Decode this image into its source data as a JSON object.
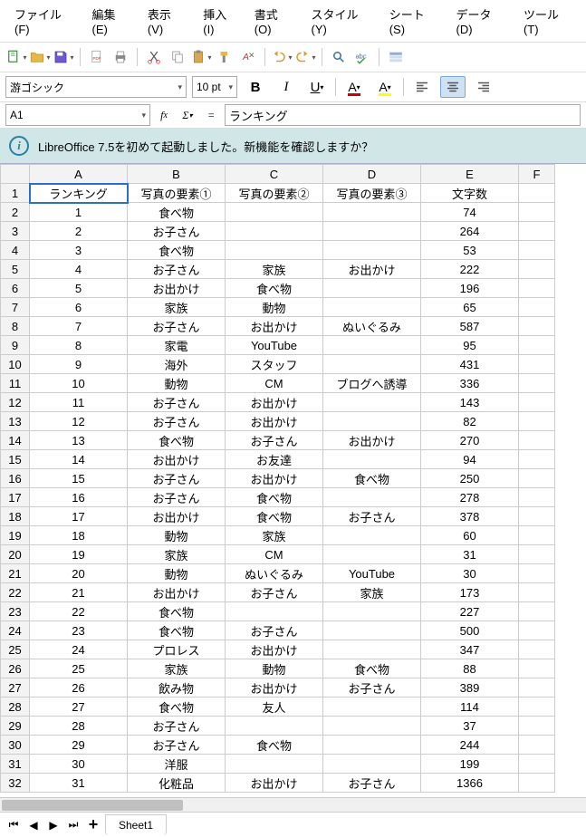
{
  "menu": {
    "file": "ファイル(F)",
    "edit": "編集(E)",
    "view": "表示(V)",
    "insert": "挿入(I)",
    "format": "書式(O)",
    "styles": "スタイル(Y)",
    "sheet": "シート(S)",
    "data": "データ(D)",
    "tools": "ツール(T)"
  },
  "format_bar": {
    "font_name": "游ゴシック",
    "font_size": "10 pt"
  },
  "formula_bar": {
    "cell_ref": "A1",
    "content": "ランキング"
  },
  "infobar": {
    "message": "LibreOffice 7.5を初めて起動しました。新機能を確認しますか？"
  },
  "columns": [
    "A",
    "B",
    "C",
    "D",
    "E",
    "F"
  ],
  "headers": {
    "A": "ランキング",
    "B": "写真の要素①",
    "C": "写真の要素②",
    "D": "写真の要素③",
    "E": "文字数"
  },
  "rows": [
    {
      "n": 1,
      "A": "ランキング",
      "B": "写真の要素①",
      "C": "写真の要素②",
      "D": "写真の要素③",
      "E": "文字数"
    },
    {
      "n": 2,
      "A": "1",
      "B": "食べ物",
      "C": "",
      "D": "",
      "E": "74"
    },
    {
      "n": 3,
      "A": "2",
      "B": "お子さん",
      "C": "",
      "D": "",
      "E": "264"
    },
    {
      "n": 4,
      "A": "3",
      "B": "食べ物",
      "C": "",
      "D": "",
      "E": "53"
    },
    {
      "n": 5,
      "A": "4",
      "B": "お子さん",
      "C": "家族",
      "D": "お出かけ",
      "E": "222"
    },
    {
      "n": 6,
      "A": "5",
      "B": "お出かけ",
      "C": "食べ物",
      "D": "",
      "E": "196"
    },
    {
      "n": 7,
      "A": "6",
      "B": "家族",
      "C": "動物",
      "D": "",
      "E": "65"
    },
    {
      "n": 8,
      "A": "7",
      "B": "お子さん",
      "C": "お出かけ",
      "D": "ぬいぐるみ",
      "E": "587"
    },
    {
      "n": 9,
      "A": "8",
      "B": "家電",
      "C": "YouTube",
      "D": "",
      "E": "95"
    },
    {
      "n": 10,
      "A": "9",
      "B": "海外",
      "C": "スタッフ",
      "D": "",
      "E": "431"
    },
    {
      "n": 11,
      "A": "10",
      "B": "動物",
      "C": "CM",
      "D": "ブログへ誘導",
      "E": "336"
    },
    {
      "n": 12,
      "A": "11",
      "B": "お子さん",
      "C": "お出かけ",
      "D": "",
      "E": "143"
    },
    {
      "n": 13,
      "A": "12",
      "B": "お子さん",
      "C": "お出かけ",
      "D": "",
      "E": "82"
    },
    {
      "n": 14,
      "A": "13",
      "B": "食べ物",
      "C": "お子さん",
      "D": "お出かけ",
      "E": "270"
    },
    {
      "n": 15,
      "A": "14",
      "B": "お出かけ",
      "C": "お友達",
      "D": "",
      "E": "94"
    },
    {
      "n": 16,
      "A": "15",
      "B": "お子さん",
      "C": "お出かけ",
      "D": "食べ物",
      "E": "250"
    },
    {
      "n": 17,
      "A": "16",
      "B": "お子さん",
      "C": "食べ物",
      "D": "",
      "E": "278"
    },
    {
      "n": 18,
      "A": "17",
      "B": "お出かけ",
      "C": "食べ物",
      "D": "お子さん",
      "E": "378"
    },
    {
      "n": 19,
      "A": "18",
      "B": "動物",
      "C": "家族",
      "D": "",
      "E": "60"
    },
    {
      "n": 20,
      "A": "19",
      "B": "家族",
      "C": "CM",
      "D": "",
      "E": "31"
    },
    {
      "n": 21,
      "A": "20",
      "B": "動物",
      "C": "ぬいぐるみ",
      "D": "YouTube",
      "E": "30"
    },
    {
      "n": 22,
      "A": "21",
      "B": "お出かけ",
      "C": "お子さん",
      "D": "家族",
      "E": "173"
    },
    {
      "n": 23,
      "A": "22",
      "B": "食べ物",
      "C": "",
      "D": "",
      "E": "227"
    },
    {
      "n": 24,
      "A": "23",
      "B": "食べ物",
      "C": "お子さん",
      "D": "",
      "E": "500"
    },
    {
      "n": 25,
      "A": "24",
      "B": "プロレス",
      "C": "お出かけ",
      "D": "",
      "E": "347"
    },
    {
      "n": 26,
      "A": "25",
      "B": "家族",
      "C": "動物",
      "D": "食べ物",
      "E": "88"
    },
    {
      "n": 27,
      "A": "26",
      "B": "飲み物",
      "C": "お出かけ",
      "D": "お子さん",
      "E": "389"
    },
    {
      "n": 28,
      "A": "27",
      "B": "食べ物",
      "C": "友人",
      "D": "",
      "E": "114"
    },
    {
      "n": 29,
      "A": "28",
      "B": "お子さん",
      "C": "",
      "D": "",
      "E": "37"
    },
    {
      "n": 30,
      "A": "29",
      "B": "お子さん",
      "C": "食べ物",
      "D": "",
      "E": "244"
    },
    {
      "n": 31,
      "A": "30",
      "B": "洋服",
      "C": "",
      "D": "",
      "E": "199"
    },
    {
      "n": 32,
      "A": "31",
      "B": "化粧品",
      "C": "お出かけ",
      "D": "お子さん",
      "E": "1366"
    }
  ],
  "tabs": {
    "sheet1": "Sheet1"
  }
}
